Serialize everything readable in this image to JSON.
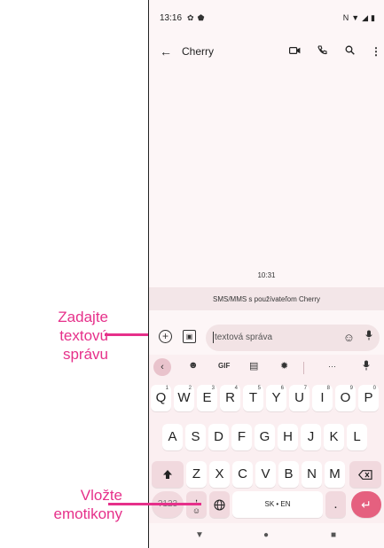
{
  "callouts": {
    "input": {
      "line1": "Zadajte",
      "line2": "textovú",
      "line3": "správu"
    },
    "emoji": {
      "line1": "Vložte",
      "line2": "emotikony"
    }
  },
  "status": {
    "time": "13:16",
    "icons_left": [
      "settings-icon",
      "shield-icon"
    ],
    "icons_right": [
      "nfc-icon",
      "wifi-icon",
      "signal-icon",
      "battery-icon"
    ],
    "nfc": "N"
  },
  "appbar": {
    "contact": "Cherry",
    "actions": [
      "video-call-icon",
      "phone-icon",
      "search-icon",
      "more-icon"
    ]
  },
  "conversation": {
    "timestamp": "10:31",
    "banner": "SMS/MMS s používateľom Cherry"
  },
  "compose": {
    "placeholder": "textová správa"
  },
  "keyboard": {
    "toolbar": {
      "gif": "GIF",
      "more": "···"
    },
    "row1": [
      {
        "key": "Q",
        "hint": "1"
      },
      {
        "key": "W",
        "hint": "2"
      },
      {
        "key": "E",
        "hint": "3"
      },
      {
        "key": "R",
        "hint": "4"
      },
      {
        "key": "T",
        "hint": "5"
      },
      {
        "key": "Y",
        "hint": "6"
      },
      {
        "key": "U",
        "hint": "7"
      },
      {
        "key": "I",
        "hint": "8"
      },
      {
        "key": "O",
        "hint": "9"
      },
      {
        "key": "P",
        "hint": "0"
      }
    ],
    "row2": [
      "A",
      "S",
      "D",
      "F",
      "G",
      "H",
      "J",
      "K",
      "L"
    ],
    "row3": [
      "Z",
      "X",
      "C",
      "V",
      "B",
      "N",
      "M"
    ],
    "row4": {
      "symbols": "?123",
      "comma": ",",
      "space": "SK • EN",
      "period": "."
    }
  }
}
